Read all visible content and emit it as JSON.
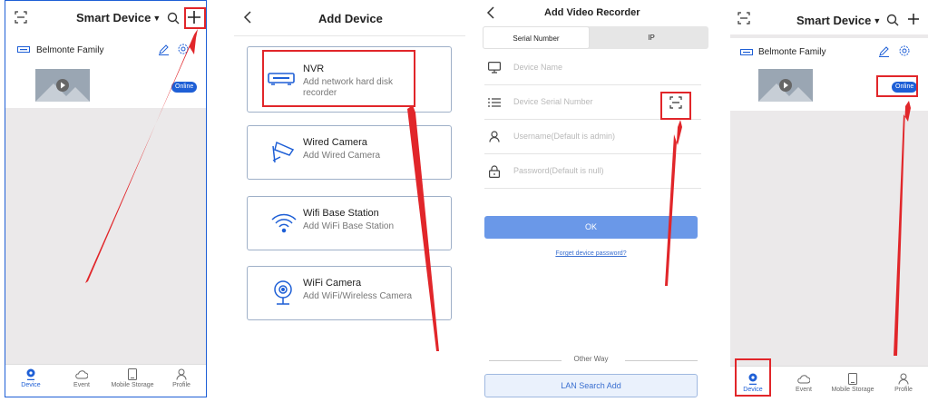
{
  "panel1": {
    "title": "Smart Device",
    "family": "Belmonte Family",
    "status": "Online",
    "nav": [
      "Device",
      "Event",
      "Mobile Storage",
      "Profile"
    ]
  },
  "panel2": {
    "title": "Add Device",
    "cards": [
      {
        "title": "NVR",
        "sub": "Add network hard disk recorder",
        "icon": "nvr-icon"
      },
      {
        "title": "Wired Camera",
        "sub": "Add Wired Camera",
        "icon": "wired-camera-icon"
      },
      {
        "title": "Wifi Base Station",
        "sub": "Add WiFi Base Station",
        "icon": "wifi-icon"
      },
      {
        "title": "WiFi Camera",
        "sub": "Add WiFi/Wireless Camera",
        "icon": "wifi-camera-icon"
      }
    ]
  },
  "panel3": {
    "title": "Add Video Recorder",
    "tabs": [
      "Serial Number",
      "IP"
    ],
    "fields": [
      {
        "placeholder": "Device Name",
        "icon": "monitor-icon"
      },
      {
        "placeholder": "Device Serial Number",
        "icon": "list-icon"
      },
      {
        "placeholder": "Username(Default is admin)",
        "icon": "user-icon"
      },
      {
        "placeholder": "Password(Default is null)",
        "icon": "lock-icon"
      }
    ],
    "ok": "OK",
    "forgot": "Forget device password?",
    "other_way": "Other Way",
    "lan": "LAN Search Add"
  },
  "panel4": {
    "title": "Smart Device",
    "family": "Belmonte Family",
    "status": "Online",
    "nav": [
      "Device",
      "Event",
      "Mobile Storage",
      "Profile"
    ]
  },
  "colors": {
    "accent": "#1e5fd6",
    "annotation": "#e1262a",
    "ok_button": "#6a98e8"
  }
}
